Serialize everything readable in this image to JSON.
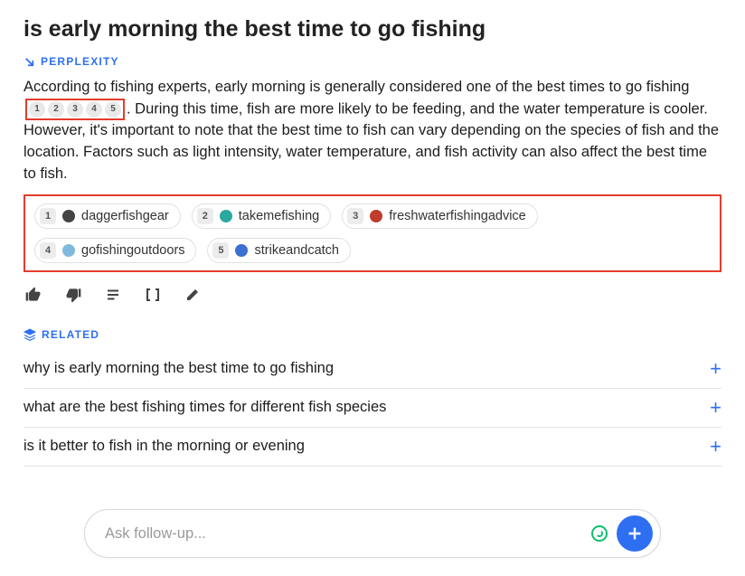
{
  "query": "is early morning the best time to go fishing",
  "brand_label": "PERPLEXITY",
  "answer_pre": "According to fishing experts, early morning is generally considered one of the best times to go fishing",
  "answer_post": ". During this time, fish are more likely to be feeding, and the water temperature is cooler. However, it's important to note that the best time to fish can vary depending on the species of fish and the location. Factors such as light intensity, water temperature, and fish activity can also affect the best time to fish.",
  "inline_citations": [
    "1",
    "2",
    "3",
    "4",
    "5"
  ],
  "sources": [
    {
      "num": "1",
      "name": "daggerfishgear",
      "color": "#444"
    },
    {
      "num": "2",
      "name": "takemefishing",
      "color": "#2aa9a0"
    },
    {
      "num": "3",
      "name": "freshwaterfishingadvice",
      "color": "#c03c2c"
    },
    {
      "num": "4",
      "name": "gofishingoutdoors",
      "color": "#7fbadc"
    },
    {
      "num": "5",
      "name": "strikeandcatch",
      "color": "#3b6fd1"
    }
  ],
  "related_label": "RELATED",
  "related": [
    "why is early morning the best time to go fishing",
    "what are the best fishing times for different fish species",
    "is it better to fish in the morning or evening"
  ],
  "followup_placeholder": "Ask follow-up..."
}
